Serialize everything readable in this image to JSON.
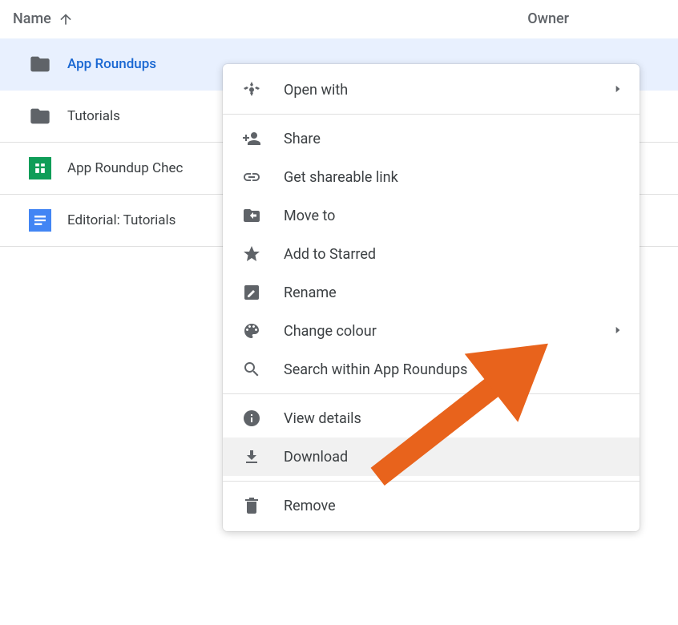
{
  "header": {
    "name_label": "Name",
    "owner_label": "Owner"
  },
  "files": [
    {
      "name": "App Roundups",
      "type": "folder",
      "selected": true
    },
    {
      "name": "Tutorials",
      "type": "folder",
      "selected": false
    },
    {
      "name": "App Roundup Chec",
      "type": "sheet",
      "selected": false
    },
    {
      "name": "Editorial: Tutorials",
      "type": "doc",
      "selected": false
    }
  ],
  "menu": {
    "open_with": "Open with",
    "share": "Share",
    "get_link": "Get shareable link",
    "move_to": "Move to",
    "add_starred": "Add to Starred",
    "rename": "Rename",
    "change_colour": "Change colour",
    "search_within": "Search within App Roundups",
    "view_details": "View details",
    "download": "Download",
    "remove": "Remove"
  }
}
